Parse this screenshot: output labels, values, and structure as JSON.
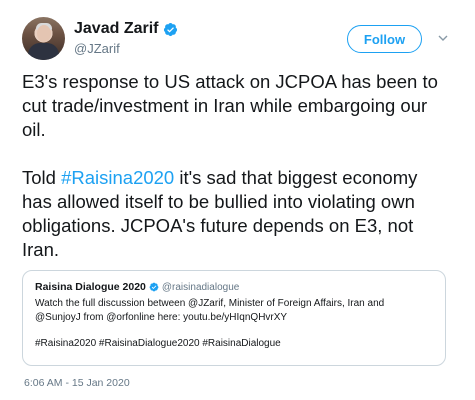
{
  "author": {
    "name": "Javad Zarif",
    "handle": "@JZarif"
  },
  "follow_label": "Follow",
  "tweet": {
    "para1": "E3's response to US attack on JCPOA has been to cut trade/investment in Iran while embargoing our oil.",
    "para2_before": "Told ",
    "para2_hashtag": "#Raisina2020",
    "para2_after": " it's sad that biggest economy has allowed itself to be bullied into violating own obligations. JCPOA's future depends on E3, not Iran."
  },
  "quoted": {
    "name": "Raisina Dialogue 2020",
    "handle": "@raisinadialogue",
    "line1": "Watch the full discussion between @JZarif, Minister of Foreign Affairs, Iran and",
    "line2": "@SunjoyJ from @orfonline here: youtu.be/yHIqnQHvrXY",
    "hashtags": "#Raisina2020 #RaisinaDialogue2020 #RaisinaDialogue"
  },
  "timestamp": "6:06 AM - 15 Jan 2020",
  "colors": {
    "accent": "#1da1f2",
    "text": "#14171a",
    "muted": "#657786"
  },
  "icons": [
    "verified-badge-icon",
    "chevron-down-icon"
  ]
}
